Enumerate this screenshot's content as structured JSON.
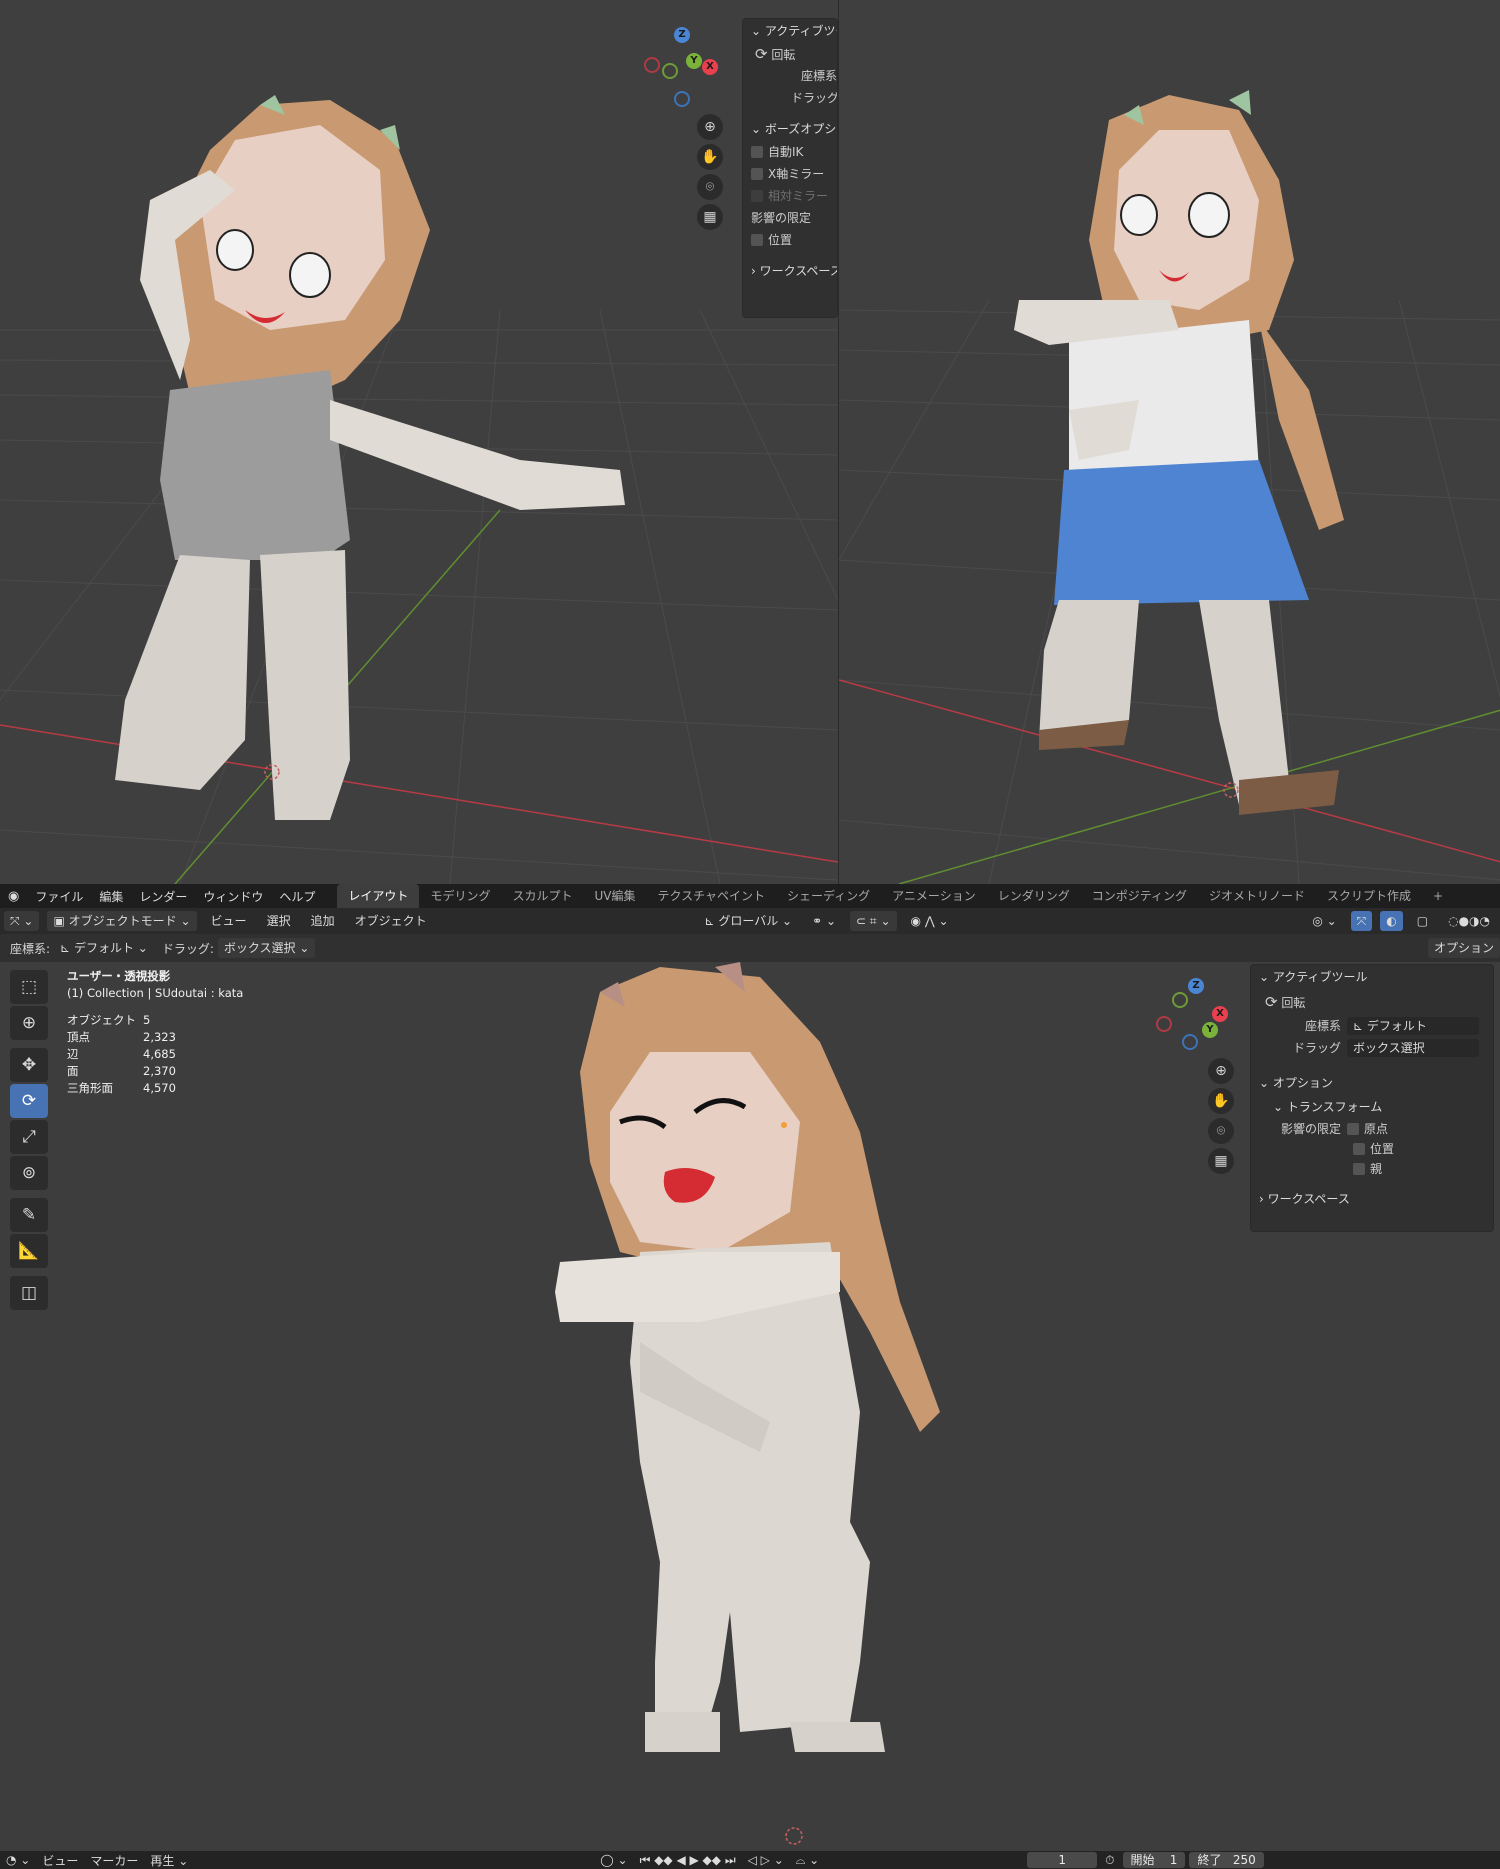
{
  "top_left_viewport": {
    "n_panel": {
      "active_tool_header": "アクティブツー",
      "tool_name": "回転",
      "coord_label": "座標系",
      "drag_label": "ドラッグ",
      "pose_options_header": "ボーズオプショ",
      "options": [
        {
          "label": "自動IK",
          "checked": false,
          "disabled": false
        },
        {
          "label": "X軸ミラー",
          "checked": false,
          "disabled": false
        },
        {
          "label": "相対ミラー",
          "checked": false,
          "disabled": true
        }
      ],
      "affect_only_label": "影響の限定",
      "position_label": "位置",
      "workspace_header": "ワークスペース"
    }
  },
  "top_bar": {
    "menus": [
      "ファイル",
      "編集",
      "レンダー",
      "ウィンドウ",
      "ヘルプ"
    ],
    "workspaces": [
      "レイアウト",
      "モデリング",
      "スカルプト",
      "UV編集",
      "テクスチャペイント",
      "シェーディング",
      "アニメーション",
      "レンダリング",
      "コンポジティング",
      "ジオメトリノード",
      "スクリプト作成"
    ],
    "active_workspace": "レイアウト",
    "add_tab": "+"
  },
  "header": {
    "mode": "オブジェクトモード",
    "menus": [
      "ビュー",
      "選択",
      "追加",
      "オブジェクト"
    ],
    "transform_orientation": "グローバル"
  },
  "tool_options": {
    "coord_label": "座標系:",
    "coord_value": "デフォルト",
    "drag_label": "ドラッグ:",
    "drag_value": "ボックス選択",
    "options_button": "オプション"
  },
  "viewport": {
    "view_name": "ユーザー・透視投影",
    "collection_line": "(1) Collection | SUdoutai : kata",
    "stats": [
      {
        "label": "オブジェクト",
        "value": "5"
      },
      {
        "label": "頂点",
        "value": "2,323"
      },
      {
        "label": "辺",
        "value": "4,685"
      },
      {
        "label": "面",
        "value": "2,370"
      },
      {
        "label": "三角形面",
        "value": "4,570"
      }
    ]
  },
  "n_panel": {
    "active_tool_header": "アクティブツール",
    "tool_name": "回転",
    "coord_label": "座標系",
    "coord_value": "デフォルト",
    "drag_label": "ドラッグ",
    "drag_value": "ボックス選択",
    "options_header": "オプション",
    "transform_header": "トランスフォーム",
    "affect_only_label": "影響の限定",
    "affect_items": [
      "原点",
      "位置",
      "親"
    ],
    "workspace_header": "ワークスペース"
  },
  "gizmo": {
    "x": "X",
    "y": "Y",
    "z": "Z"
  },
  "timeline": {
    "view": "ビュー",
    "marker": "マーカー",
    "playback": "再生",
    "current_frame": "1",
    "start_label": "開始",
    "start_value": "1",
    "end_label": "終了",
    "end_value": "250"
  },
  "colors": {
    "accent": "#4772b3",
    "x_axis": "#e8404f",
    "y_axis": "#7bb33a",
    "z_axis": "#4a86d4"
  }
}
